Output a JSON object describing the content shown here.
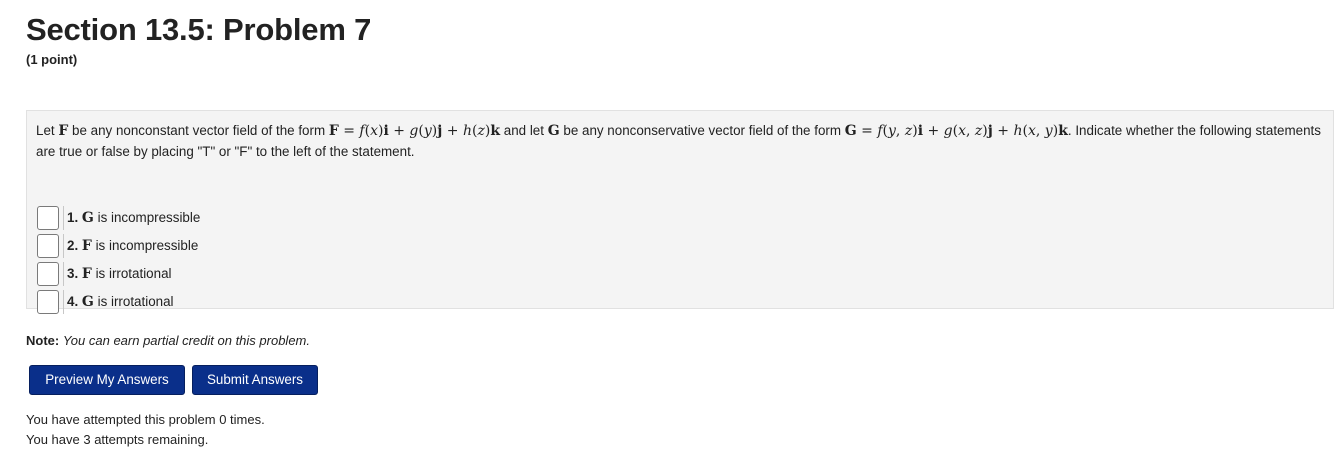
{
  "header": {
    "title": "Section 13.5: Problem 7",
    "points": "(1 point)"
  },
  "problem": {
    "intro_1": "Let ",
    "F": "F",
    "intro_2": " be any nonconstant vector field of the form ",
    "F_form": "F = f(x)i + g(y)j + h(z)k",
    "intro_3": " and let ",
    "G": "G",
    "intro_4": " be any nonconservative vector field of the form ",
    "G_form": "G = f(y, z)i + g(x, z)j + h(x, y)k",
    "intro_5": ". Indicate whether the following statements are true or false by placing \"T\" or \"F\" to the left of the statement.",
    "statements": [
      {
        "num": "1.",
        "field": "G",
        "text": " is incompressible",
        "value": ""
      },
      {
        "num": "2.",
        "field": "F",
        "text": " is incompressible",
        "value": ""
      },
      {
        "num": "3.",
        "field": "F",
        "text": " is irrotational",
        "value": ""
      },
      {
        "num": "4.",
        "field": "G",
        "text": " is irrotational",
        "value": ""
      }
    ]
  },
  "note": {
    "label": "Note:",
    "text": "You can earn partial credit on this problem."
  },
  "buttons": {
    "preview_label": "Preview My Answers",
    "submit_label": "Submit Answers"
  },
  "status": {
    "attempts_made": "You have attempted this problem 0 times.",
    "attempts_remaining": "You have 3 attempts remaining."
  },
  "colors": {
    "button_bg": "#0a2f8a",
    "problem_bg": "#f4f4f4"
  }
}
